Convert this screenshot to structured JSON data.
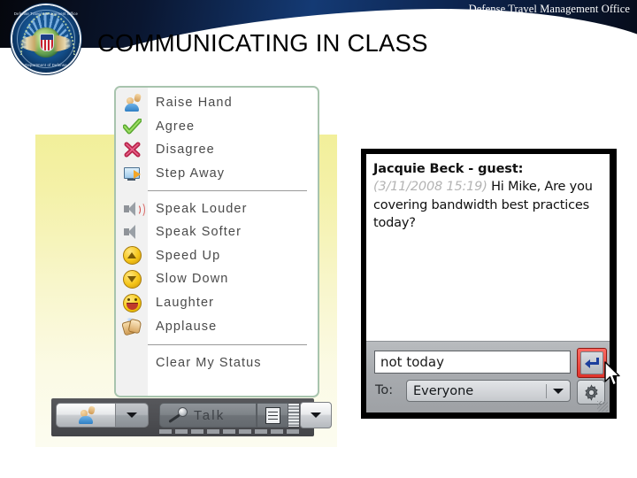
{
  "header": {
    "org": "Defense Travel Management Office",
    "title": "COMMUNICATING IN CLASS",
    "seal_text_top": "Defense Travel Management Office",
    "seal_text_bottom": "Department of Defense",
    "colors": {
      "band_dark": "#0a1630",
      "band_blue": "#143a74"
    }
  },
  "status_menu": {
    "groups": [
      {
        "items": [
          {
            "icon": "raise-hand-icon",
            "label": "Raise Hand"
          },
          {
            "icon": "check-icon",
            "label": "Agree"
          },
          {
            "icon": "x-icon",
            "label": "Disagree"
          },
          {
            "icon": "step-away-icon",
            "label": "Step Away"
          }
        ]
      },
      {
        "items": [
          {
            "icon": "speaker-loud-icon",
            "label": "Speak Louder"
          },
          {
            "icon": "speaker-soft-icon",
            "label": "Speak Softer"
          },
          {
            "icon": "arrow-up-circle-icon",
            "label": "Speed Up"
          },
          {
            "icon": "arrow-down-circle-icon",
            "label": "Slow Down"
          },
          {
            "icon": "laughter-icon",
            "label": "Laughter"
          },
          {
            "icon": "applause-icon",
            "label": "Applause"
          }
        ]
      },
      {
        "items": [
          {
            "icon": "",
            "label": "Clear My Status"
          }
        ]
      }
    ]
  },
  "toolbar": {
    "raise_hand_icon": "raise-hand-icon",
    "raise_hand_dropdown_icon": "chevron-down-icon",
    "talk_label": "Talk",
    "talk_icon": "microphone-icon",
    "notes_icon": "document-icon",
    "meter_name": "audio-level-meter",
    "options_dropdown_icon": "chevron-down-icon"
  },
  "chat": {
    "message": {
      "sender": "Jacquie Beck - guest:",
      "timestamp": "(3/11/2008 15:19)",
      "text": "Hi Mike, Are you covering bandwidth best practices today?"
    },
    "input_value": "not today",
    "input_placeholder": "",
    "send_icon": "enter-arrow-icon",
    "send_highlight_color": "#e0332b",
    "to_label": "To:",
    "to_value": "Everyone",
    "to_options": [
      "Everyone"
    ],
    "to_dropdown_icon": "chevron-down-icon",
    "settings_icon": "gear-icon",
    "resize_icon": "resize-grip-icon",
    "cursor_icon": "mouse-pointer-icon"
  }
}
